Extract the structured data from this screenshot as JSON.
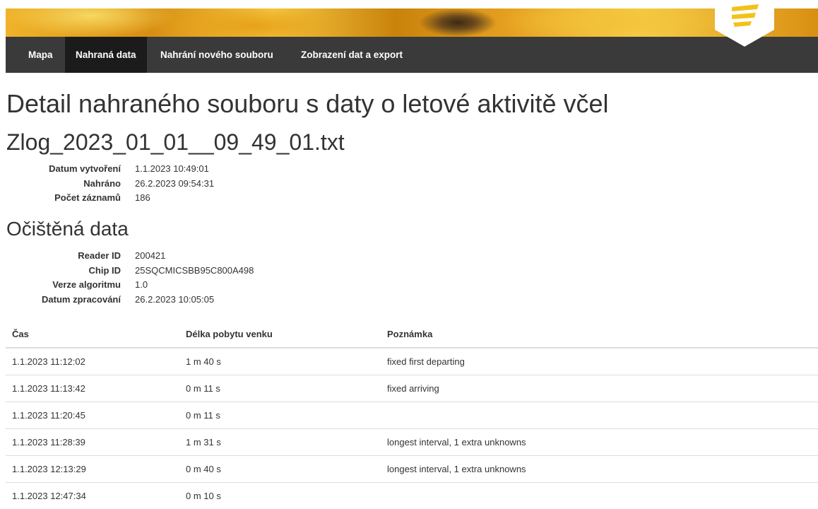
{
  "nav": {
    "items": [
      {
        "label": "Mapa"
      },
      {
        "label": "Nahraná data"
      },
      {
        "label": "Nahrání nového souboru"
      },
      {
        "label": "Zobrazení dat a export"
      }
    ],
    "active_index": 1
  },
  "page_title": "Detail nahraného souboru s daty o letové aktivitě včel",
  "file": {
    "name": "Zlog_2023_01_01__09_49_01.txt",
    "details": [
      {
        "label": "Datum vytvoření",
        "value": "1.1.2023 10:49:01"
      },
      {
        "label": "Nahráno",
        "value": "26.2.2023 09:54:31"
      },
      {
        "label": "Počet záznamů",
        "value": "186"
      }
    ]
  },
  "clean_data": {
    "heading": "Očištěná data",
    "details": [
      {
        "label": "Reader ID",
        "value": "200421"
      },
      {
        "label": "Chip ID",
        "value": "25SQCMICSBB95C800A498"
      },
      {
        "label": "Verze algoritmu",
        "value": "1.0"
      },
      {
        "label": "Datum zpracování",
        "value": "26.2.2023 10:05:05"
      }
    ]
  },
  "table": {
    "headers": [
      "Čas",
      "Délka pobytu venku",
      "Poznámka"
    ],
    "rows": [
      [
        "1.1.2023 11:12:02",
        "1 m 40 s",
        "fixed first departing"
      ],
      [
        "1.1.2023 11:13:42",
        "0 m 11 s",
        "fixed arriving"
      ],
      [
        "1.1.2023 11:20:45",
        "0 m 11 s",
        ""
      ],
      [
        "1.1.2023 11:28:39",
        "1 m 31 s",
        "longest interval, 1 extra unknowns"
      ],
      [
        "1.1.2023 12:13:29",
        "0 m 40 s",
        "longest interval, 1 extra unknowns"
      ],
      [
        "1.1.2023 12:47:34",
        "0 m 10 s",
        ""
      ]
    ]
  },
  "colors": {
    "navbar": "#3a3a3a",
    "nav_active": "#1b1b1b",
    "logo_accent": "#f2c21b"
  },
  "icons": {
    "logo": "hive-logo-icon",
    "banner": "honeybee-banner-image"
  }
}
